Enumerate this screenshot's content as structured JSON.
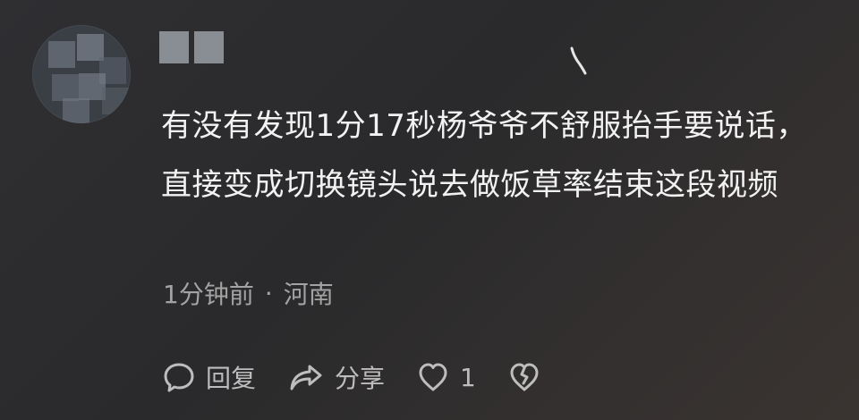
{
  "comment": {
    "text": "有没有发现1分17秒杨爷爷不舒服抬手要说话，直接变成切换镜头说去做饭草率结束这段视频",
    "time": "1分钟前",
    "location": "河南"
  },
  "actions": {
    "reply_label": "回复",
    "share_label": "分享",
    "like_count": "1"
  },
  "icons": {
    "reply": "chat-bubble-icon",
    "share": "share-arrow-icon",
    "like": "heart-icon",
    "dislike": "broken-heart-icon"
  },
  "colors": {
    "background": "#2d2d30",
    "text": "#f2f2f2",
    "meta": "#a3a3a3",
    "action": "#bdbdbd"
  }
}
